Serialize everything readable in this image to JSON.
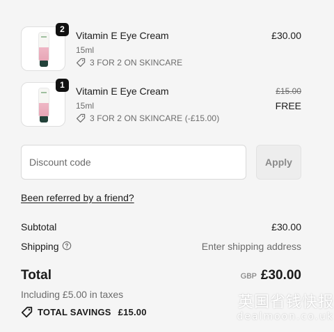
{
  "cart": {
    "items": [
      {
        "name": "Vitamin E Eye Cream",
        "variant": "15ml",
        "quantity": "2",
        "promo": "3 FOR 2 ON SKINCARE",
        "price": "£30.00"
      },
      {
        "name": "Vitamin E Eye Cream",
        "variant": "15ml",
        "quantity": "1",
        "promo": "3 FOR 2 ON SKINCARE (-£15.00)",
        "original_price": "£15.00",
        "price": "FREE"
      }
    ]
  },
  "discount": {
    "placeholder": "Discount code",
    "apply_label": "Apply"
  },
  "referral": {
    "link_text": "Been referred by a friend?"
  },
  "summary": {
    "subtotal_label": "Subtotal",
    "subtotal_value": "£30.00",
    "shipping_label": "Shipping",
    "shipping_value": "Enter shipping address",
    "total_label": "Total",
    "currency": "GBP",
    "total_value": "£30.00",
    "taxes_note": "Including £5.00 in taxes",
    "savings_label": "TOTAL SAVINGS",
    "savings_value": "£15.00"
  },
  "watermark": {
    "chinese": "英国省钱快报",
    "domain": "dealmoon.co.uk"
  },
  "icons": {
    "tag": "tag-icon",
    "info": "info-circle-icon",
    "savings": "tag-icon"
  },
  "colors": {
    "background": "#f5f5f5",
    "text": "#1a1a1a",
    "muted": "#6b6b6b",
    "badge": "#111111"
  }
}
